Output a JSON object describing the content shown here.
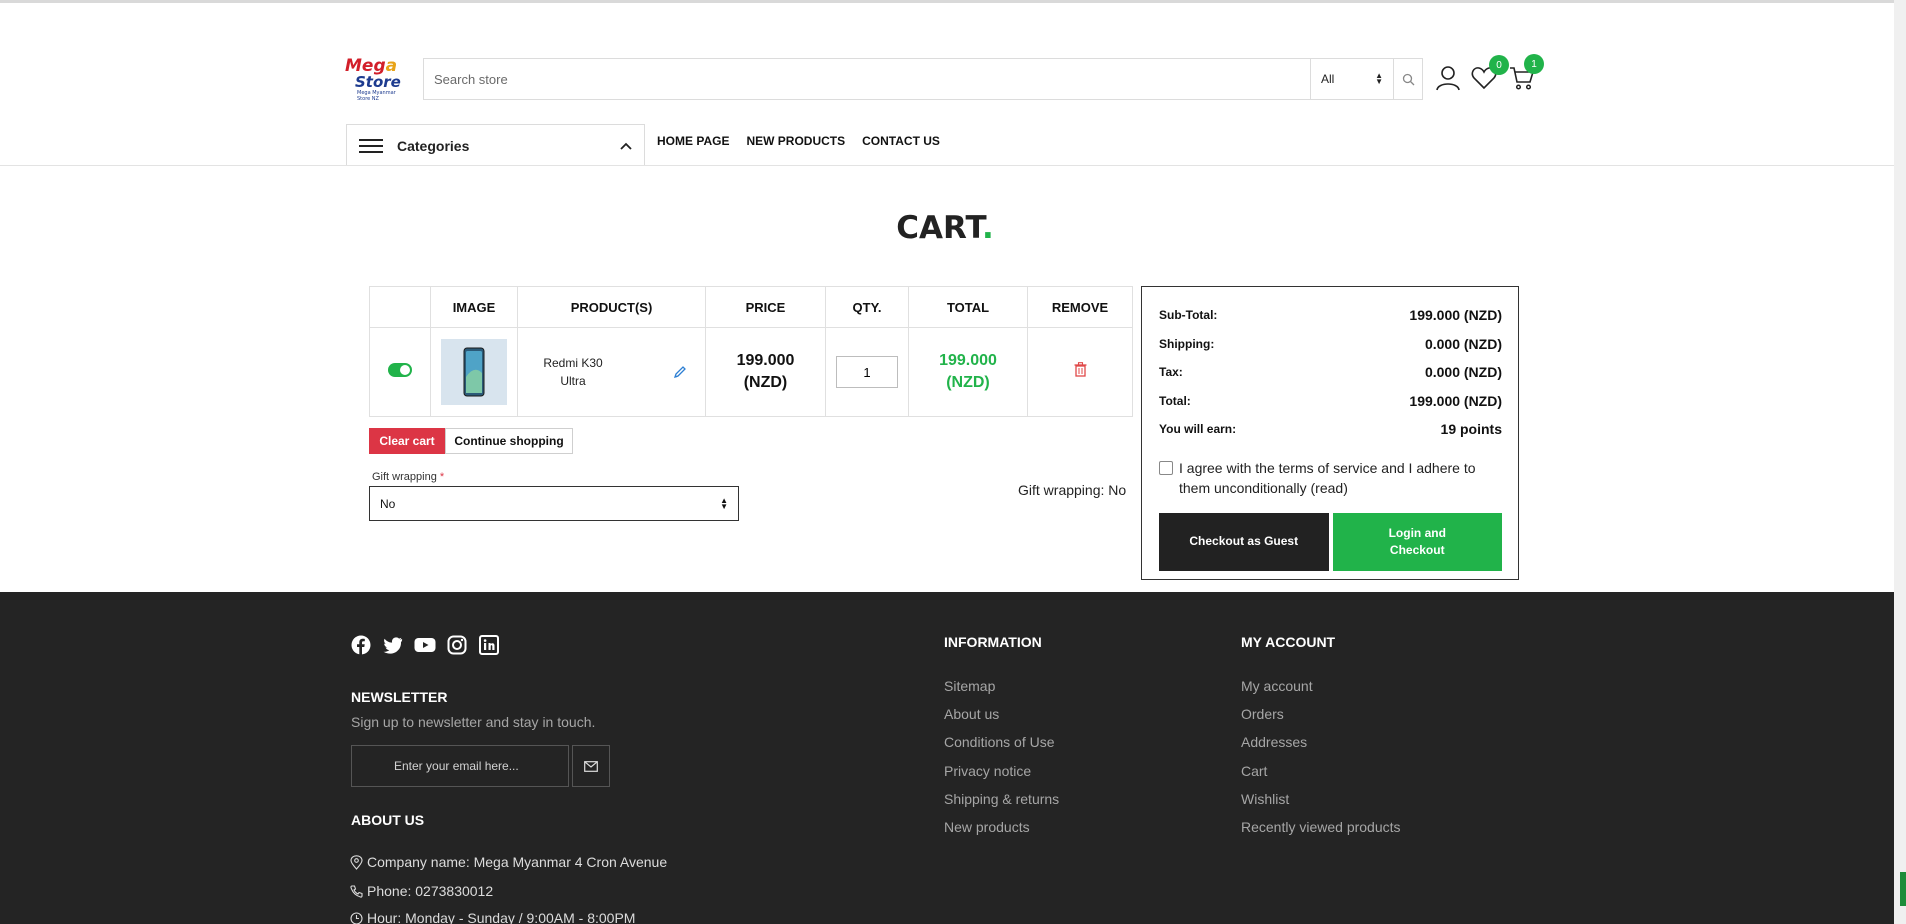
{
  "header": {
    "logo": {
      "line1a": "Meg",
      "line1b": "a",
      "line2": "Store",
      "tagline": "Mega Myanmar Store NZ"
    },
    "search": {
      "placeholder": "Search store",
      "category": "All"
    },
    "wishlist_count": "0",
    "cart_count": "1"
  },
  "nav": {
    "categories_label": "Categories",
    "links": [
      "HOME PAGE",
      "NEW PRODUCTS",
      "CONTACT US"
    ]
  },
  "page": {
    "title": "CART",
    "title_dot": "."
  },
  "cart": {
    "headers": [
      "",
      "IMAGE",
      "PRODUCT(S)",
      "PRICE",
      "QTY.",
      "TOTAL",
      "REMOVE"
    ],
    "items": [
      {
        "name": "Redmi K30 Ultra",
        "price": "199.000 (NZD)",
        "qty": "1",
        "total": "199.000 (NZD)",
        "selected": true
      }
    ],
    "clear_label": "Clear cart",
    "continue_label": "Continue shopping",
    "gift_wrapping_label": "Gift wrapping",
    "gift_wrapping_value": "No",
    "gift_wrapping_status": "Gift wrapping: No"
  },
  "summary": {
    "rows": [
      {
        "label": "Sub-Total:",
        "value": "199.000 (NZD)"
      },
      {
        "label": "Shipping:",
        "value": "0.000 (NZD)"
      },
      {
        "label": "Tax:",
        "value": "0.000 (NZD)"
      },
      {
        "label": "Total:",
        "value": "199.000 (NZD)"
      },
      {
        "label": "You will earn:",
        "value": "19 points"
      }
    ],
    "terms_text": "I agree with the terms of service and I adhere to them unconditionally (read)",
    "checkout_guest_label": "Checkout as Guest",
    "login_checkout_label": "Login and Checkout"
  },
  "footer": {
    "newsletter": {
      "title": "NEWSLETTER",
      "subtitle": "Sign up to newsletter and stay in touch.",
      "placeholder": "Enter your email here..."
    },
    "about": {
      "title": "ABOUT US",
      "company": "Company name: Mega Myanmar 4 Cron Avenue",
      "phone": "Phone: 0273830012",
      "hours": "Hour: Monday - Sunday / 9:00AM - 8:00PM"
    },
    "information": {
      "title": "INFORMATION",
      "links": [
        "Sitemap",
        "About us",
        "Conditions of Use",
        "Privacy notice",
        "Shipping & returns",
        "New products"
      ]
    },
    "my_account": {
      "title": "MY ACCOUNT",
      "links": [
        "My account",
        "Orders",
        "Addresses",
        "Cart",
        "Wishlist",
        "Recently viewed products"
      ]
    }
  },
  "colors": {
    "accent": "#21b34a",
    "danger": "#dc3545",
    "footer_bg": "#242424"
  }
}
